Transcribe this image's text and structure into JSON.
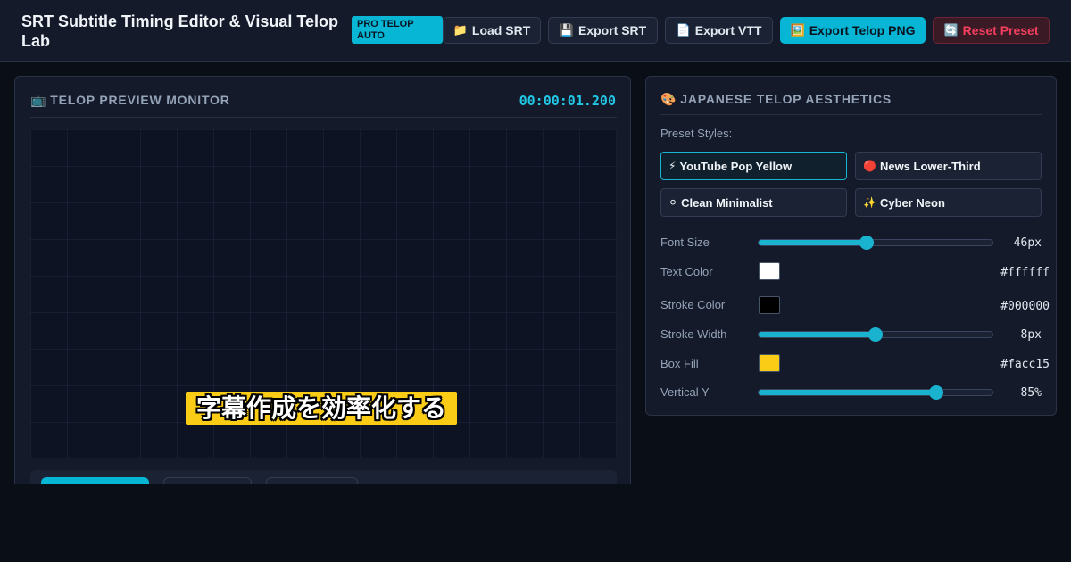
{
  "header": {
    "title": "SRT Subtitle Timing Editor & Visual Telop Lab",
    "badge": "PRO TELOP AUTO",
    "buttons": {
      "load_srt": {
        "icon": "📁",
        "label": "Load SRT"
      },
      "export_srt": {
        "icon": "💾",
        "label": "Export SRT"
      },
      "export_vtt": {
        "icon": "📄",
        "label": "Export VTT"
      },
      "export_png": {
        "icon": "🖼️",
        "label": "Export Telop PNG"
      },
      "reset": {
        "icon": "🔄",
        "label": "Reset Preset"
      }
    }
  },
  "preview": {
    "icon": "📺",
    "title": "TELOP PREVIEW MONITOR",
    "timecode": "00:00:01.200",
    "telop_text": "字幕作成を効率化する"
  },
  "aesthetics": {
    "icon": "🎨",
    "title": "JAPANESE TELOP AESTHETICS",
    "preset_label": "Preset Styles:",
    "presets": [
      {
        "icon": "⚡",
        "label": "YouTube Pop Yellow",
        "active": true
      },
      {
        "icon": "🔴",
        "label": "News Lower-Third",
        "active": false
      },
      {
        "icon": "⚪",
        "label": "Clean Minimalist",
        "active": false
      },
      {
        "icon": "✨",
        "label": "Cyber Neon",
        "active": false
      }
    ],
    "controls": {
      "font_size": {
        "label": "Font Size",
        "value": "46px",
        "level": 0.46
      },
      "text_color": {
        "label": "Text Color",
        "value": "#ffffff"
      },
      "stroke_color": {
        "label": "Stroke Color",
        "value": "#000000"
      },
      "stroke_width": {
        "label": "Stroke Width",
        "value": "8px",
        "level": 0.5
      },
      "box_fill": {
        "label": "Box Fill",
        "value": "#facc15"
      },
      "vertical_y": {
        "label": "Vertical Y",
        "value": "85%",
        "level": 0.76
      }
    }
  },
  "colors": {
    "accent": "#06b6d4",
    "danger": "#f43f5e",
    "background": "#0a0e17"
  }
}
